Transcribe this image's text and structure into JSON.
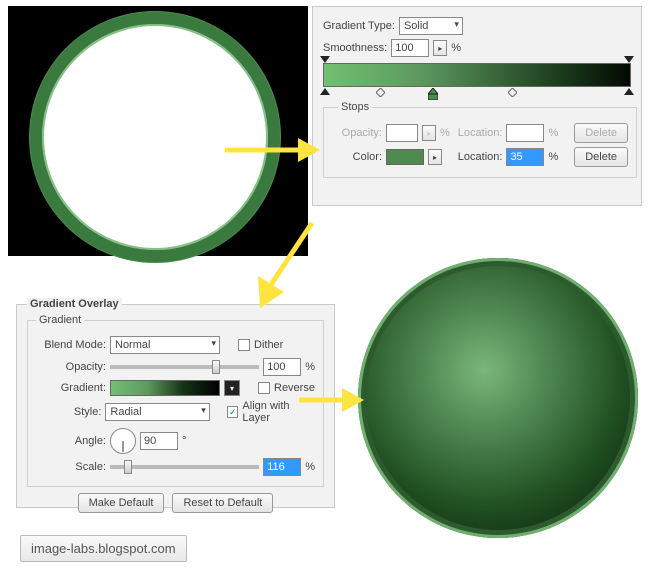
{
  "gradient_editor": {
    "type_label": "Gradient Type:",
    "type_value": "Solid",
    "smoothness_label": "Smoothness:",
    "smoothness_value": "100",
    "percent": "%",
    "stops_legend": "Stops",
    "opacity_label": "Opacity:",
    "opacity_value": "",
    "location_label": "Location:",
    "location_top_value": "",
    "delete_label": "Delete",
    "color_label": "Color:",
    "color_hex": "#4f8b4f",
    "location_bottom_value": "35"
  },
  "gradient_overlay": {
    "panel_title": "Gradient Overlay",
    "group_title": "Gradient",
    "blend_mode_label": "Blend Mode:",
    "blend_mode_value": "Normal",
    "dither_label": "Dither",
    "opacity_label": "Opacity:",
    "opacity_value": "100",
    "gradient_label": "Gradient:",
    "reverse_label": "Reverse",
    "style_label": "Style:",
    "style_value": "Radial",
    "align_label": "Align with Layer",
    "angle_label": "Angle:",
    "angle_value": "90",
    "degree": "°",
    "scale_label": "Scale:",
    "scale_value": "116",
    "percent": "%",
    "make_default": "Make Default",
    "reset_default": "Reset to Default"
  },
  "watermark": "image-labs.blogspot.com"
}
